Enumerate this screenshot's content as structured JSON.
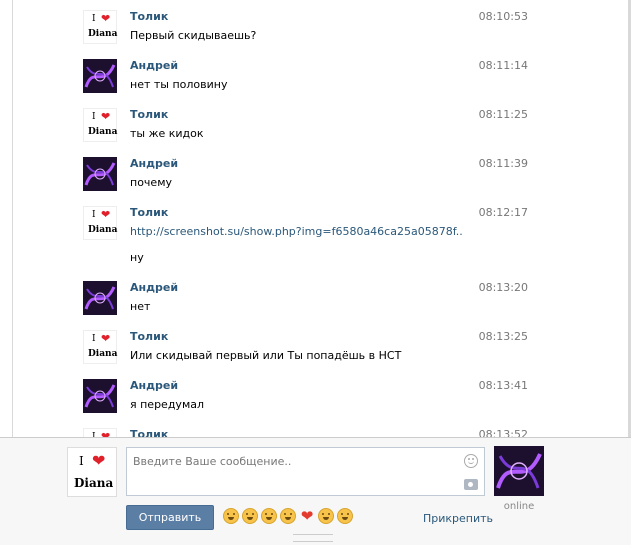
{
  "messages": [
    {
      "author": "Толик",
      "time": "08:10:53",
      "text": "Первый скидываешь?"
    },
    {
      "author": "Андрей",
      "time": "08:11:14",
      "text": "нет ты половину"
    },
    {
      "author": "Толик",
      "time": "08:11:25",
      "text": "ты же кидок"
    },
    {
      "author": "Андрей",
      "time": "08:11:39",
      "text": "почему"
    },
    {
      "author": "Толик",
      "time": "08:12:17",
      "text": "http://screenshot.su/show.php?img=f6580a46ca25a05878f..",
      "text2": "ну"
    },
    {
      "author": "Андрей",
      "time": "08:13:20",
      "text": "нет"
    },
    {
      "author": "Толик",
      "time": "08:13:25",
      "text": "Или скидывай первый или Ты попадёшь в НСТ"
    },
    {
      "author": "Андрей",
      "time": "08:13:41",
      "text": "я передумал"
    },
    {
      "author": "Толик",
      "time": "08:13:52",
      "text": ""
    }
  ],
  "avatar_diana": {
    "i": "I",
    "name": "Diana",
    "heart_icon": "heart-icon"
  },
  "composer": {
    "placeholder": "Введите Ваше сообщение..",
    "send_label": "Отправить",
    "attach_label": "Прикрепить",
    "peer_status": "online",
    "emoji_icons": [
      "smile-icon",
      "kiss-icon",
      "grin-icon",
      "wink-icon",
      "heart-icon",
      "cry-icon",
      "laugh-icon"
    ]
  },
  "colors": {
    "link": "#2b587a",
    "send_button": "#5b7ea4"
  }
}
